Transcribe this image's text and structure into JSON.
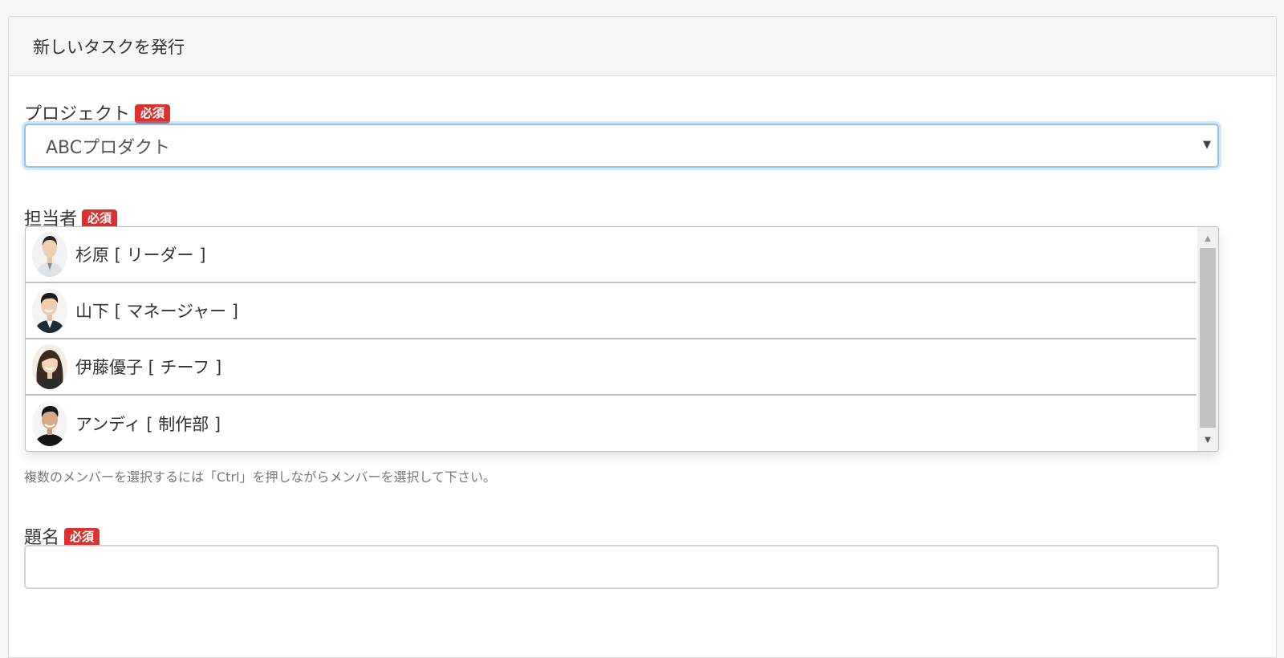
{
  "panel": {
    "title": "新しいタスクを発行"
  },
  "project": {
    "label": "プロジェクト",
    "required": "必須",
    "selected": "ABCプロダクト",
    "arrow_icon": "▼"
  },
  "assignee": {
    "label": "担当者",
    "required": "必須",
    "options": [
      {
        "name": "杉原 [ リーダー ]",
        "avatar": "man-short-hair-avatar"
      },
      {
        "name": "山下 [ マネージャー ]",
        "avatar": "smiling-man-avatar"
      },
      {
        "name": "伊藤優子 [ チーフ ]",
        "avatar": "woman-avatar"
      },
      {
        "name": "アンディ [ 制作部 ]",
        "avatar": "man-dark-hair-avatar"
      }
    ],
    "help": "複数のメンバーを選択するには「Ctrl」を押しながらメンバーを選択して下さい。"
  },
  "subject": {
    "label": "題名",
    "required": "必須",
    "value": "",
    "placeholder": ""
  },
  "colors": {
    "required_badge": "#d9322f",
    "focus_border": "#8ec3ee"
  }
}
